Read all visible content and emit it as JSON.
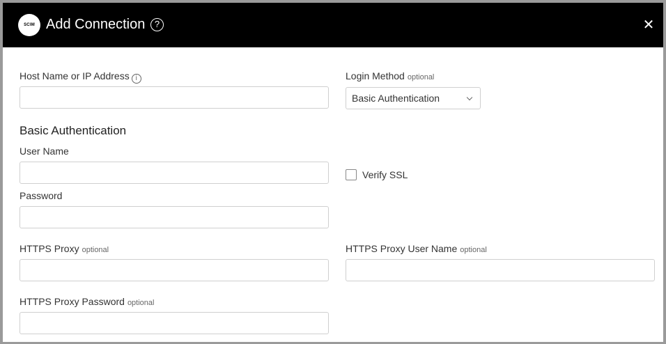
{
  "header": {
    "logo_text": "SCIM",
    "title": "Add Connection",
    "help_icon": "?",
    "close_icon": "✕"
  },
  "form": {
    "host": {
      "label": "Host Name or IP Address",
      "info_icon": "i",
      "value": ""
    },
    "login_method": {
      "label": "Login Method",
      "optional": "optional",
      "value": "Basic Authentication"
    },
    "section_title": "Basic Authentication",
    "user_name": {
      "label": "User Name",
      "value": ""
    },
    "verify_ssl": {
      "label": "Verify SSL",
      "checked": false
    },
    "password": {
      "label": "Password",
      "value": ""
    },
    "https_proxy": {
      "label": "HTTPS Proxy",
      "optional": "optional",
      "value": ""
    },
    "https_proxy_user": {
      "label": "HTTPS Proxy User Name",
      "optional": "optional",
      "value": ""
    },
    "https_proxy_password": {
      "label": "HTTPS Proxy Password",
      "optional": "optional",
      "value": ""
    }
  }
}
